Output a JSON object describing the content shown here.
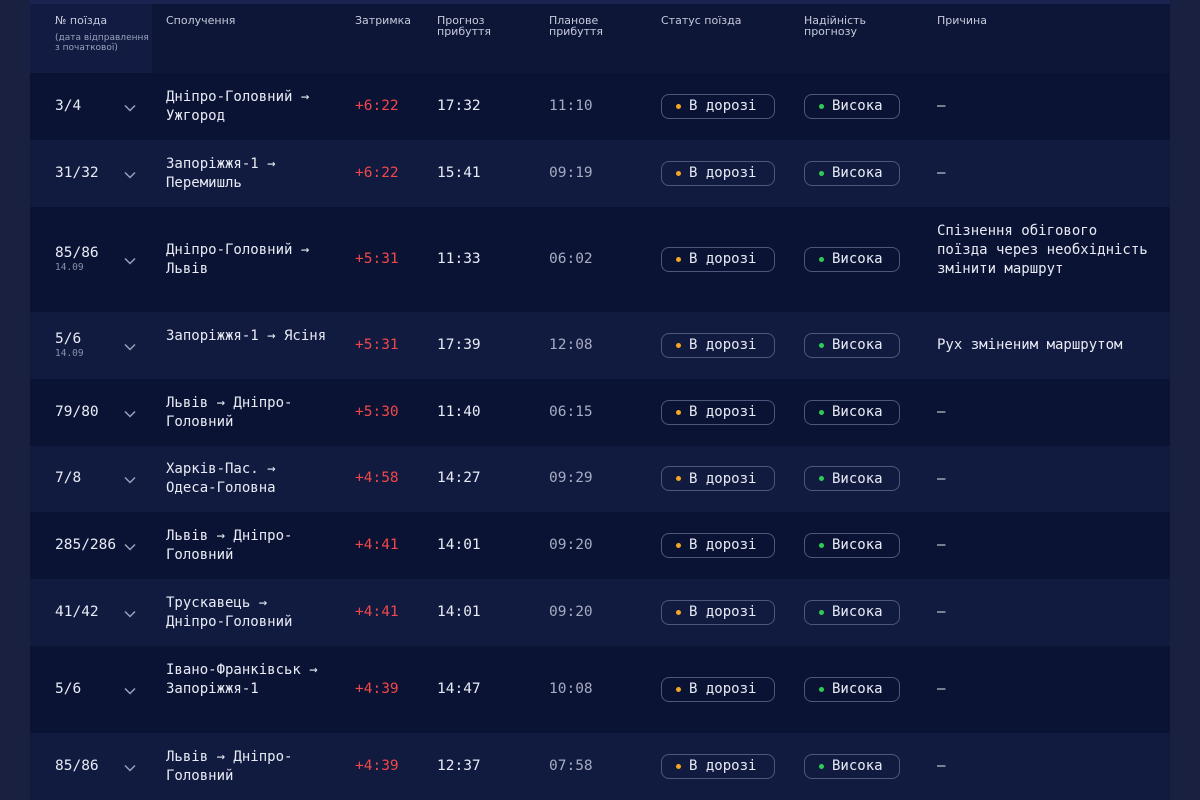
{
  "colors": {
    "page_bg": "#1a2140",
    "table_bg": "#0b1233",
    "delay": "#f0484a",
    "status_dot": "#f5a623",
    "reliability_dot": "#2ecc55",
    "pill_border": "#4d567d"
  },
  "header": {
    "train_no": "№ поїзда",
    "train_no_sub": "(дата відправлення з початкової)",
    "route": "Сполучення",
    "delay": "Затримка",
    "forecast": "Прогноз прибуття",
    "planned": "Планове прибуття",
    "status": "Статус поїзда",
    "reliability": "Надійність прогнозу",
    "reason": "Причина"
  },
  "rows": [
    {
      "train": "3/4",
      "date": "",
      "route": "Дніпро-Головний → Ужгород",
      "delay": "+6:22",
      "forecast": "17:32",
      "planned": "11:10",
      "status": "В дорозі",
      "reliability": "Висока",
      "reason": "—"
    },
    {
      "train": "31/32",
      "date": "",
      "route": "Запоріжжя-1 → Перемишль",
      "delay": "+6:22",
      "forecast": "15:41",
      "planned": "09:19",
      "status": "В дорозі",
      "reliability": "Висока",
      "reason": "—"
    },
    {
      "train": "85/86",
      "date": "14.09",
      "route": "Дніпро-Головний → Львів",
      "delay": "+5:31",
      "forecast": "11:33",
      "planned": "06:02",
      "status": "В дорозі",
      "reliability": "Висока",
      "reason": "Спізнення обігового поїзда через необхідність змінити маршрут"
    },
    {
      "train": "5/6",
      "date": "14.09",
      "route": "Запоріжжя-1 → Ясіня",
      "delay": "+5:31",
      "forecast": "17:39",
      "planned": "12:08",
      "status": "В дорозі",
      "reliability": "Висока",
      "reason": "Рух зміненим маршрутом"
    },
    {
      "train": "79/80",
      "date": "",
      "route": "Львів → Дніпро-Головний",
      "delay": "+5:30",
      "forecast": "11:40",
      "planned": "06:15",
      "status": "В дорозі",
      "reliability": "Висока",
      "reason": "—"
    },
    {
      "train": "7/8",
      "date": "",
      "route": "Харків-Пас. → Одеса-Головна",
      "delay": "+4:58",
      "forecast": "14:27",
      "planned": "09:29",
      "status": "В дорозі",
      "reliability": "Висока",
      "reason": "—"
    },
    {
      "train": "285/286",
      "date": "",
      "route": "Львів → Дніпро-Головний",
      "delay": "+4:41",
      "forecast": "14:01",
      "planned": "09:20",
      "status": "В дорозі",
      "reliability": "Висока",
      "reason": "—"
    },
    {
      "train": "41/42",
      "date": "",
      "route": "Трускавець → Дніпро-Головний",
      "delay": "+4:41",
      "forecast": "14:01",
      "planned": "09:20",
      "status": "В дорозі",
      "reliability": "Висока",
      "reason": "—"
    },
    {
      "train": "5/6",
      "date": "",
      "route": "Івано-Франківськ → Запоріжжя-1",
      "delay": "+4:39",
      "forecast": "14:47",
      "planned": "10:08",
      "status": "В дорозі",
      "reliability": "Висока",
      "reason": "—"
    },
    {
      "train": "85/86",
      "date": "",
      "route": "Львів → Дніпро-Головний",
      "delay": "+4:39",
      "forecast": "12:37",
      "planned": "07:58",
      "status": "В дорозі",
      "reliability": "Висока",
      "reason": "—"
    }
  ]
}
